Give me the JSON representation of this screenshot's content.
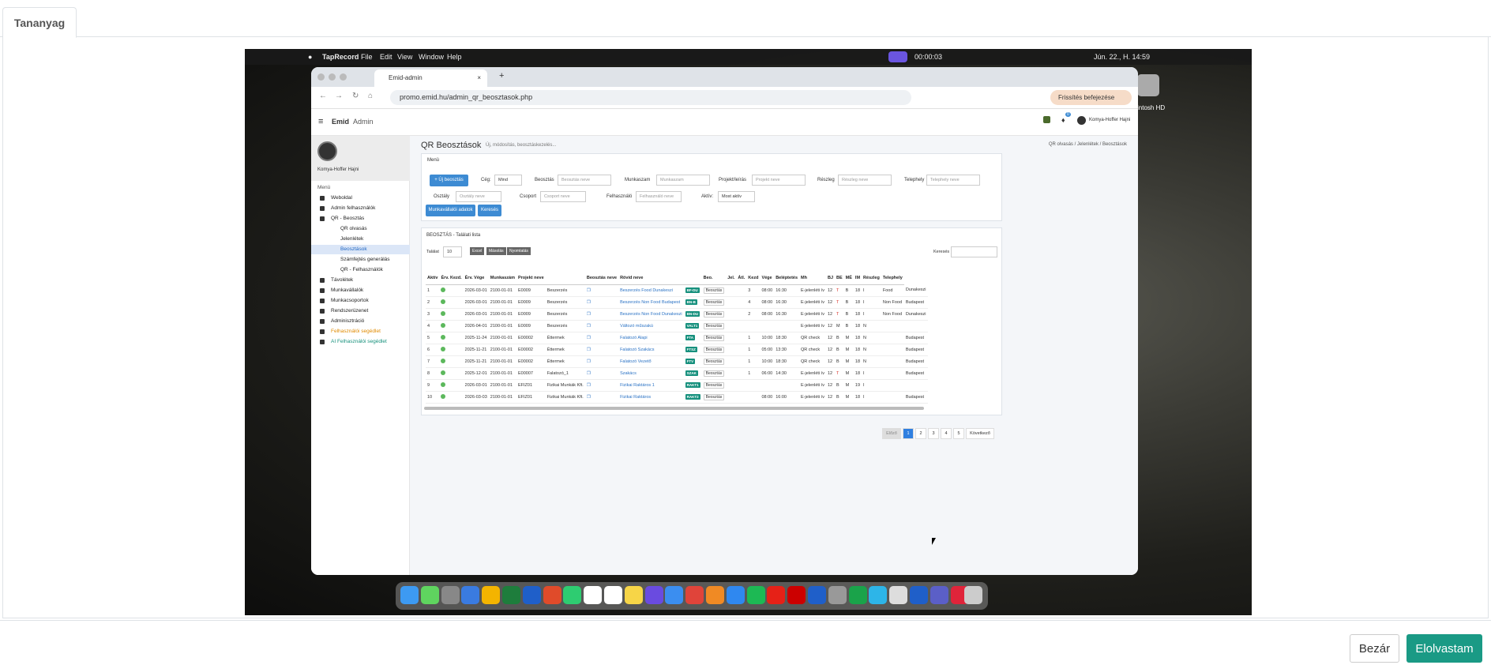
{
  "outer": {
    "tab_label": "Tananyag",
    "close_label": "Bezár",
    "read_label": "Elolvastam"
  },
  "menubar": {
    "app": "TapRecord",
    "items": [
      "File",
      "Edit",
      "View",
      "Window",
      "Help"
    ],
    "timer": "00:00:03",
    "clock": "Jún. 22., H. 14:59"
  },
  "desktop": {
    "disk_label": "cintosh HD"
  },
  "browser": {
    "tab_title": "Emid-admin",
    "url": "promo.emid.hu/admin_qr_beosztasok.php",
    "finish_label": "Frissítés befejezése"
  },
  "app": {
    "brand": "Emid",
    "brand_suffix": "Admin",
    "user": "Komya-Hoffer Hajni",
    "notif_count": "0"
  },
  "sidebar": {
    "profile_name": "Komya-Hoffer Hajni",
    "menu_title": "Menü",
    "items": [
      {
        "label": "Weboldal",
        "sub": false,
        "active": false
      },
      {
        "label": "Admin felhasználók",
        "sub": false,
        "active": false
      },
      {
        "label": "QR - Beosztás",
        "sub": false,
        "active": false
      },
      {
        "label": "QR olvasás",
        "sub": true,
        "active": false
      },
      {
        "label": "Jelenlétek",
        "sub": true,
        "active": false
      },
      {
        "label": "Beosztások",
        "sub": true,
        "active": true
      },
      {
        "label": "Számfejtés generálás",
        "sub": true,
        "active": false
      },
      {
        "label": "QR - Felhasználók",
        "sub": true,
        "active": false
      },
      {
        "label": "Távolétek",
        "sub": false,
        "active": false
      },
      {
        "label": "Munkavállalók",
        "sub": false,
        "active": false
      },
      {
        "label": "Munkacsoportok",
        "sub": false,
        "active": false
      },
      {
        "label": "Rendszerüzenet",
        "sub": false,
        "active": false
      },
      {
        "label": "Adminisztráció",
        "sub": false,
        "active": false
      },
      {
        "label": "Felhasználói segédlet",
        "sub": false,
        "active": false,
        "color": "#e08a00"
      },
      {
        "label": "AI Felhasználói segédlet",
        "sub": false,
        "active": false,
        "color": "#17917c"
      }
    ]
  },
  "page": {
    "title": "QR Beosztások",
    "subtitle": "Új, módosítás, beosztáskezelés...",
    "breadcrumb": [
      "QR olvasás",
      "Jelenlétek",
      "Beosztások"
    ]
  },
  "filters": {
    "panel_title": "Menü",
    "new_button": "+ Új beosztás",
    "ceg_label": "Cég:",
    "ceg_value": "Mind",
    "fields": [
      {
        "label": "Beosztás",
        "placeholder": "Beosztás neve"
      },
      {
        "label": "Munkaszam",
        "placeholder": "Munkaszam"
      },
      {
        "label": "Projekt/leírás",
        "placeholder": "Projekt neve"
      },
      {
        "label": "Részleg",
        "placeholder": "Részleg neve"
      },
      {
        "label": "Telephely",
        "placeholder": "Telephely neve"
      },
      {
        "label": "Osztály",
        "placeholder": "Osztály neve"
      },
      {
        "label": "Csoport",
        "placeholder": "Csoport neve"
      },
      {
        "label": "Felhasználó",
        "placeholder": "Felhasználó neve"
      }
    ],
    "aktiv_label": "Aktív:",
    "aktiv_value": "Most aktív",
    "worker_button": "Munkavállalói adatok",
    "search_button": "Keresés"
  },
  "list": {
    "title": "BEOSZTÁS - Találati lista",
    "talalat_label": "Találat",
    "talalat_value": "10",
    "buttons": [
      "Excel",
      "Másolás",
      "Nyomtatás"
    ],
    "search_label": "Keresés",
    "columns": [
      "Aktív",
      "Érv. Kezd.",
      "Érv. Vége",
      "Munkaszám",
      "Projekt neve",
      "",
      "Beosztás neve",
      "Rövid neve",
      "",
      "Beo.",
      "Jel.",
      "Átl.",
      "Kezd",
      "Vége",
      "Beléptetés",
      "Mh",
      "BJ",
      "BE",
      "MÉ",
      "IM",
      "Részleg",
      "Telephely"
    ],
    "rows": [
      [
        "1",
        "2026-03-01",
        "2100-01-01",
        "E0009",
        "Beszerzés",
        "Beszerzés Food Dunakeszi",
        "BF-DU",
        "Beosztás",
        "3",
        "08:00",
        "16:30",
        "E-jelenléti ív",
        "12",
        "T",
        "B",
        "18",
        "I",
        "Food",
        "Dunakeszi"
      ],
      [
        "2",
        "2026-03-01",
        "2100-01-01",
        "E0009",
        "Beszerzés",
        "Beszerzés Non Food Budapest",
        "BN-B",
        "Beosztás",
        "4",
        "08:00",
        "16:30",
        "E-jelenléti ív",
        "12",
        "T",
        "B",
        "18",
        "I",
        "Non Food",
        "Budapest"
      ],
      [
        "3",
        "2026-03-01",
        "2100-01-01",
        "E0009",
        "Beszerzés",
        "Beszerzés Non Food Dunakeszi",
        "BN-DU",
        "Beosztás",
        "2",
        "08:00",
        "16:30",
        "E-jelenléti ív",
        "12",
        "T",
        "B",
        "18",
        "I",
        "Non Food",
        "Dunakeszi"
      ],
      [
        "4",
        "2026-04-01",
        "2100-01-01",
        "E0009",
        "Beszerzés",
        "Változó műszakú",
        "VALT1",
        "Beosztás",
        "",
        "",
        "",
        "E-jelenléti ív",
        "12",
        "M",
        "B",
        "18",
        "N",
        "",
        ""
      ],
      [
        "5",
        "2025-11-24",
        "2100-01-01",
        "E00002",
        "Éttermek",
        "Falatozó Alapi",
        "FTA",
        "Beosztás",
        "1",
        "10:00",
        "18:30",
        "QR check",
        "12",
        "B",
        "M",
        "18",
        "N",
        "",
        "Budapest"
      ],
      [
        "6",
        "2025-11-21",
        "2100-01-01",
        "E00002",
        "Éttermek",
        "Falatozó Szakács",
        "FTSZ",
        "Beosztás",
        "1",
        "05:00",
        "13:30",
        "QR check",
        "12",
        "B",
        "M",
        "18",
        "N",
        "",
        "Budapest"
      ],
      [
        "7",
        "2025-11-21",
        "2100-01-01",
        "E00002",
        "Éttermek",
        "Falatozó Vezető",
        "FTV",
        "Beosztás",
        "1",
        "10:00",
        "18:30",
        "QR check",
        "12",
        "B",
        "M",
        "18",
        "N",
        "",
        "Budapest"
      ],
      [
        "8",
        "2025-12-01",
        "2100-01-01",
        "E00007",
        "Falatozó_1",
        "Szakács",
        "SZAK",
        "Beosztás",
        "1",
        "06:00",
        "14:30",
        "E-jelenléti ív",
        "12",
        "T",
        "M",
        "18",
        "I",
        "",
        "Budapest"
      ],
      [
        "9",
        "2026-03-01",
        "2100-01-01",
        "EFIZ01",
        "Fizikai Munkák Kft.",
        "Fizikai Raktáros 1",
        "RAKT1",
        "Beosztás",
        "",
        "",
        "",
        "E-jelenléti ív",
        "12",
        "B",
        "M",
        "19",
        "I",
        "",
        ""
      ],
      [
        "10",
        "2026-03-03",
        "2100-01-01",
        "EFIZ01",
        "Fizikai Munkák Kft.",
        "Fizikai Raktáros",
        "RAKT2",
        "Beosztás",
        "",
        "08:00",
        "16:00",
        "E-jelenléti ív",
        "12",
        "B",
        "M",
        "18",
        "I",
        "",
        "Budapest"
      ]
    ],
    "pagination": [
      "Előző",
      "1",
      "2",
      "3",
      "4",
      "5",
      "Következő"
    ]
  }
}
